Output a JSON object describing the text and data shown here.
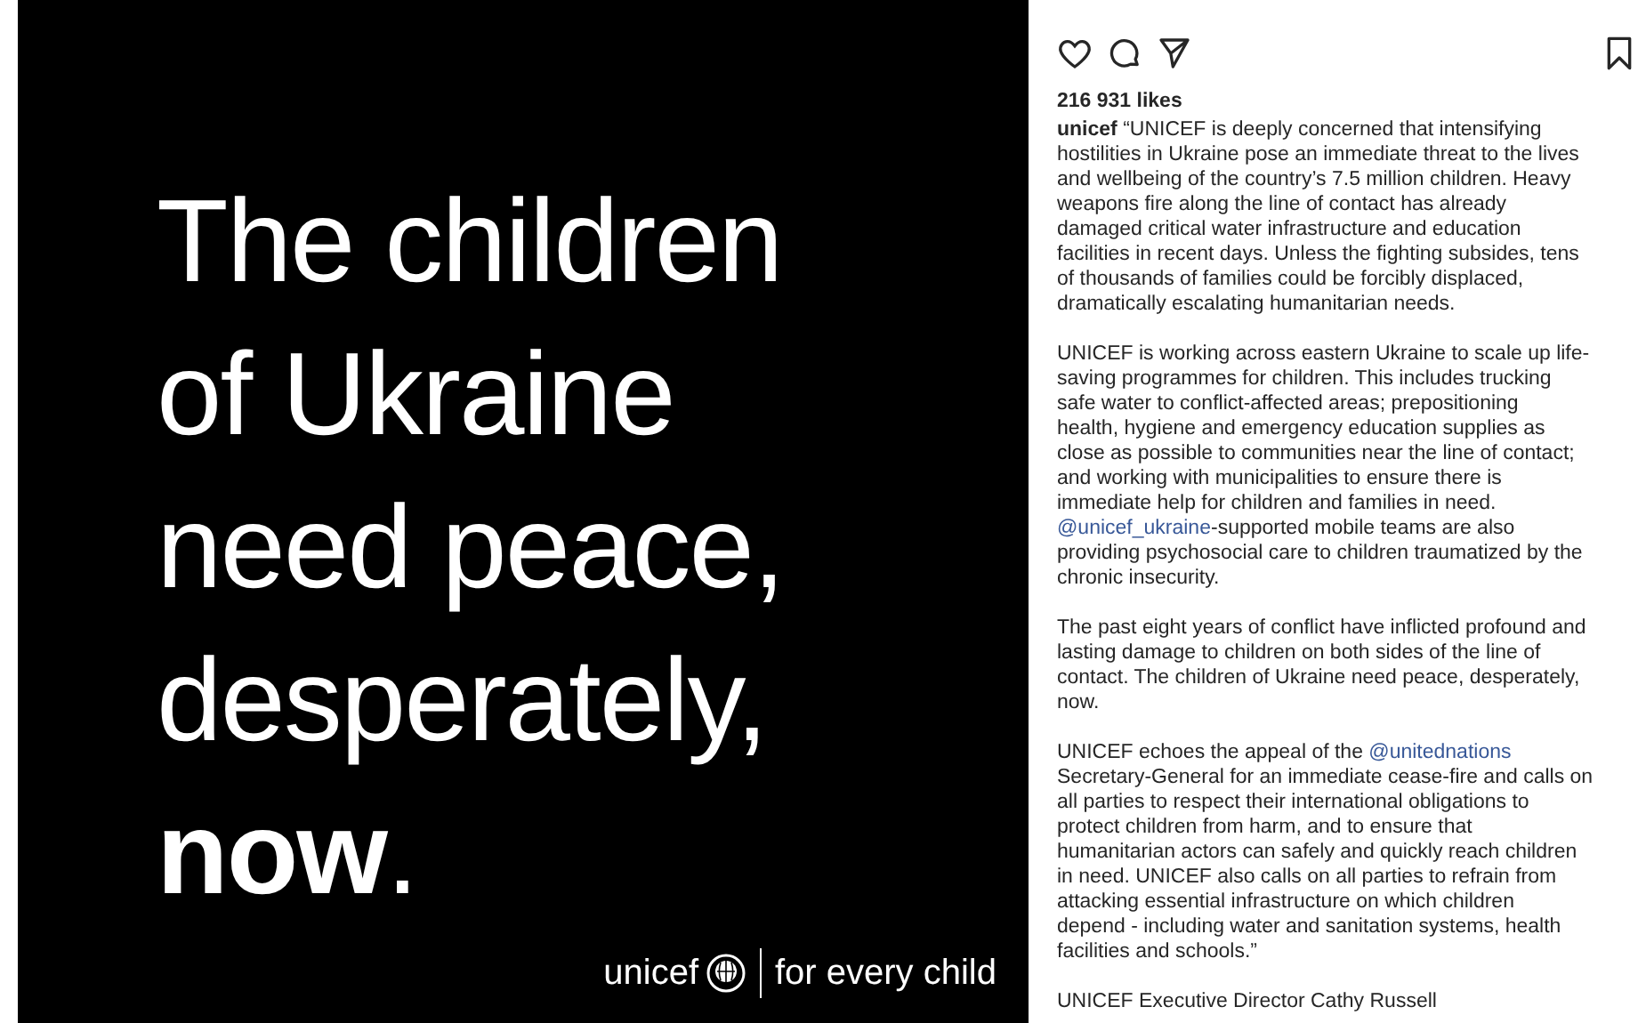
{
  "post_image": {
    "headline_lines": [
      "The children",
      "of Ukraine",
      "need peace,",
      "desperately,",
      "**now**."
    ],
    "logo_wordmark": "unicef",
    "tagline": "for every child"
  },
  "actions": {
    "liked": false,
    "saved": false
  },
  "likes": "216 931 likes",
  "caption": {
    "paragraphs": [
      {
        "lines": [
          [
            {
              "kind": "text",
              "text": "**unicef** “UNICEF is deeply concerned that intensifying"
            }
          ],
          [
            {
              "kind": "text",
              "text": "hostilities in Ukraine pose an immediate threat to the lives"
            }
          ],
          [
            {
              "kind": "text",
              "text": "and wellbeing of the country’s 7.5 million children. Heavy"
            }
          ],
          [
            {
              "kind": "text",
              "text": "weapons fire along the line of contact has already"
            }
          ],
          [
            {
              "kind": "text",
              "text": "damaged critical water infrastructure and education"
            }
          ],
          [
            {
              "kind": "text",
              "text": "facilities in recent days. Unless the fighting subsides, tens"
            }
          ],
          [
            {
              "kind": "text",
              "text": "of thousands of families could be forcibly displaced,"
            }
          ],
          [
            {
              "kind": "text",
              "text": "dramatically escalating humanitarian needs."
            }
          ]
        ]
      },
      {
        "lines": [
          [
            {
              "kind": "text",
              "text": "UNICEF is working across eastern Ukraine to scale up life-"
            }
          ],
          [
            {
              "kind": "text",
              "text": "saving programmes for children. This includes trucking"
            }
          ],
          [
            {
              "kind": "text",
              "text": "safe water to conflict-affected areas; prepositioning"
            }
          ],
          [
            {
              "kind": "text",
              "text": "health, hygiene and emergency education supplies as"
            }
          ],
          [
            {
              "kind": "text",
              "text": "close as possible to communities near the line of contact;"
            }
          ],
          [
            {
              "kind": "text",
              "text": "and working with municipalities to ensure there is"
            }
          ],
          [
            {
              "kind": "text",
              "text": "immediate help for children and families in need."
            }
          ],
          [
            {
              "kind": "link",
              "text": "@unicef_ukraine"
            },
            {
              "kind": "text",
              "text": "-supported mobile teams are also"
            }
          ],
          [
            {
              "kind": "text",
              "text": "providing psychosocial care to children traumatized by the"
            }
          ],
          [
            {
              "kind": "text",
              "text": "chronic insecurity."
            }
          ]
        ]
      },
      {
        "lines": [
          [
            {
              "kind": "text",
              "text": "The past eight years of conflict have inflicted profound and"
            }
          ],
          [
            {
              "kind": "text",
              "text": "lasting damage to children on both sides of the line of"
            }
          ],
          [
            {
              "kind": "text",
              "text": "contact. The children of Ukraine need peace, desperately,"
            }
          ],
          [
            {
              "kind": "text",
              "text": "now."
            }
          ]
        ]
      },
      {
        "lines": [
          [
            {
              "kind": "text",
              "text": "UNICEF echoes the appeal of the "
            },
            {
              "kind": "link",
              "text": "@unitednations"
            }
          ],
          [
            {
              "kind": "text",
              "text": "Secretary-General for an immediate cease-fire and calls on"
            }
          ],
          [
            {
              "kind": "text",
              "text": "all parties to respect their international obligations to"
            }
          ],
          [
            {
              "kind": "text",
              "text": "protect children from harm, and to ensure that"
            }
          ],
          [
            {
              "kind": "text",
              "text": "humanitarian actors can safely and quickly reach children"
            }
          ],
          [
            {
              "kind": "text",
              "text": "in need. UNICEF also calls on all parties to refrain from"
            }
          ],
          [
            {
              "kind": "text",
              "text": "attacking essential infrastructure on which children"
            }
          ],
          [
            {
              "kind": "text",
              "text": "depend - including water and sanitation systems, health"
            }
          ],
          [
            {
              "kind": "text",
              "text": "facilities and schools.”"
            }
          ]
        ]
      },
      {
        "lines": [
          [
            {
              "kind": "text",
              "text": "UNICEF Executive Director Cathy Russell"
            }
          ]
        ]
      }
    ]
  }
}
